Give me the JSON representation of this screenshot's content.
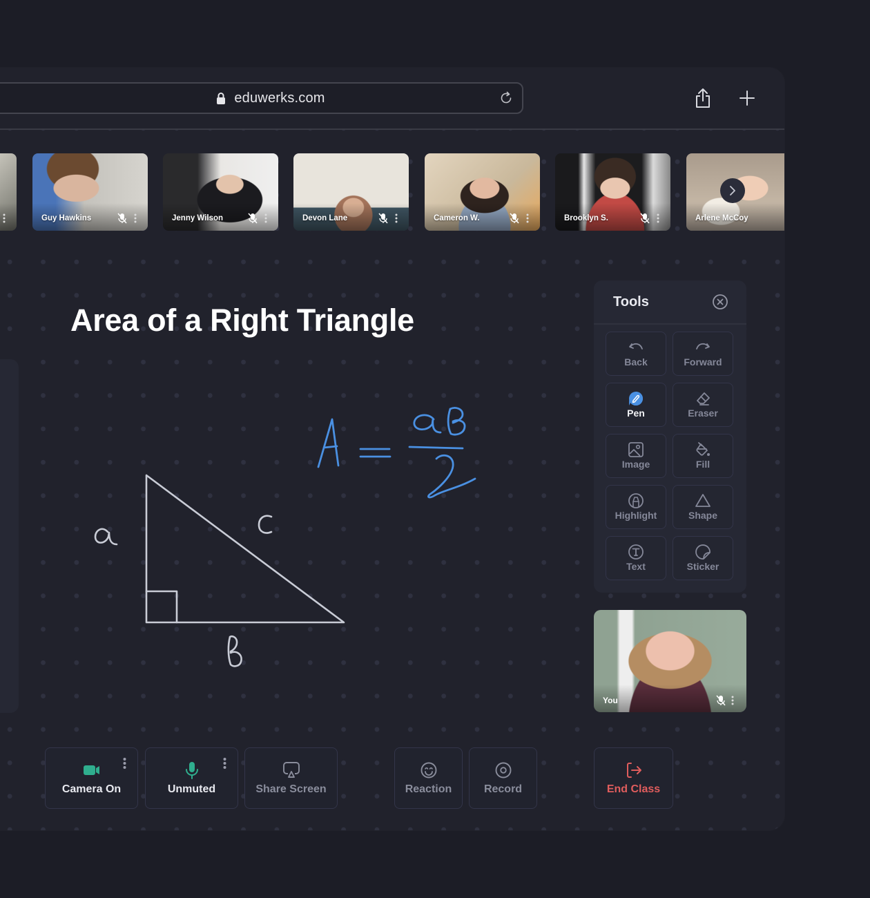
{
  "browser": {
    "url": "eduwerks.com",
    "icons": [
      "lock-icon",
      "reload-icon",
      "share-icon",
      "new-tab-icon"
    ]
  },
  "participants": [
    {
      "name": "",
      "muted": true
    },
    {
      "name": "Guy Hawkins",
      "muted": true
    },
    {
      "name": "Jenny Wilson",
      "muted": true
    },
    {
      "name": "Devon Lane",
      "muted": true
    },
    {
      "name": "Cameron  W.",
      "muted": true
    },
    {
      "name": "Brooklyn S.",
      "muted": true
    },
    {
      "name": "Arlene McCoy",
      "muted": true
    }
  ],
  "board": {
    "title": "Area of a Right Triangle",
    "formula": "A = ab/2",
    "labels": {
      "a": "a",
      "b": "b",
      "c": "c"
    }
  },
  "tools": {
    "title": "Tools",
    "items": [
      {
        "label": "Back",
        "icon": "undo-icon",
        "active": false
      },
      {
        "label": "Forward",
        "icon": "redo-icon",
        "active": false
      },
      {
        "label": "Pen",
        "icon": "pen-icon",
        "active": true
      },
      {
        "label": "Eraser",
        "icon": "eraser-icon",
        "active": false
      },
      {
        "label": "Image",
        "icon": "image-icon",
        "active": false
      },
      {
        "label": "Fill",
        "icon": "fill-icon",
        "active": false
      },
      {
        "label": "Highlight",
        "icon": "highlight-icon",
        "active": false
      },
      {
        "label": "Shape",
        "icon": "shape-icon",
        "active": false
      },
      {
        "label": "Text",
        "icon": "text-icon",
        "active": false
      },
      {
        "label": "Sticker",
        "icon": "sticker-icon",
        "active": false
      }
    ]
  },
  "self_view": {
    "name": "You",
    "muted": true
  },
  "controls": {
    "camera": "Camera On",
    "mic": "Unmuted",
    "share": "Share Screen",
    "reaction": "Reaction",
    "record": "Record",
    "end": "End Class"
  },
  "colors": {
    "accent_blue": "#4a90e2",
    "active_green": "#2fae8e",
    "danger_red": "#e05d5d",
    "chalk": "#c9ccd6"
  }
}
